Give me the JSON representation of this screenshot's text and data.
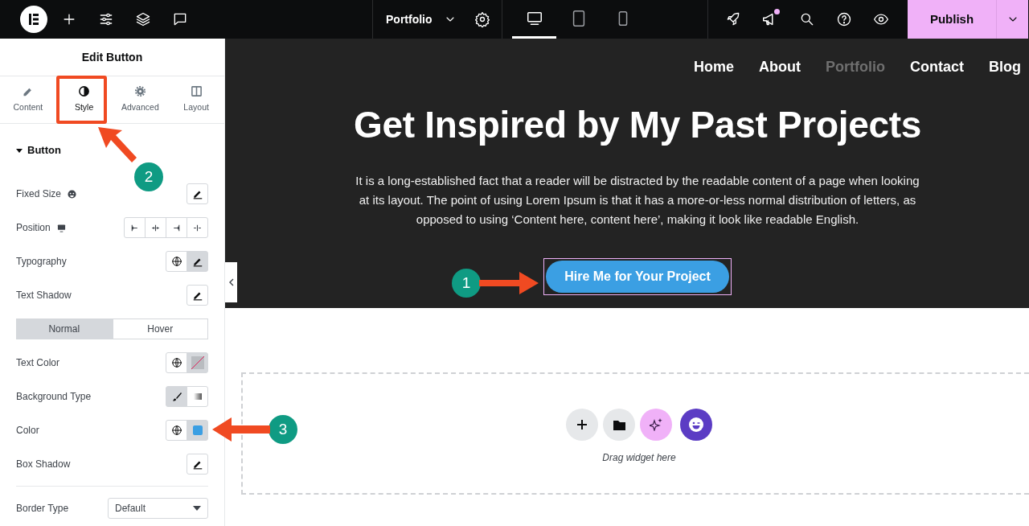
{
  "topbar": {
    "page_title": "Portfolio",
    "devices": [
      {
        "selected": true
      },
      {
        "selected": false
      },
      {
        "selected": false
      }
    ],
    "notification": true,
    "publish": "Publish"
  },
  "panel": {
    "title": "Edit Button",
    "tabs": [
      {
        "label": "Content",
        "selected": false
      },
      {
        "label": "Style",
        "selected": true
      },
      {
        "label": "Advanced",
        "selected": false
      },
      {
        "label": "Layout",
        "selected": false
      }
    ],
    "section": {
      "title": "Button",
      "expanded": true
    },
    "controls": [
      {
        "kind": "edit",
        "label": "Fixed Size",
        "dynamic": true
      },
      {
        "kind": "align",
        "label": "Position",
        "responsive": true
      },
      {
        "kind": "global_edit",
        "label": "Typography"
      },
      {
        "kind": "edit",
        "label": "Text Shadow"
      },
      {
        "kind": "states",
        "options": [
          {
            "label": "Normal",
            "selected": true
          },
          {
            "label": "Hover",
            "selected": false
          }
        ]
      },
      {
        "kind": "global_color",
        "label": "Text Color"
      },
      {
        "kind": "choice",
        "label": "Background Type",
        "options": [
          {
            "selected": true
          },
          {
            "selected": false
          }
        ]
      },
      {
        "kind": "global_color",
        "label": "Color",
        "color": "#3b9fe3"
      },
      {
        "kind": "edit",
        "label": "Box Shadow"
      },
      {
        "kind": "select",
        "label": "Border Type",
        "value": "Default"
      }
    ]
  },
  "site": {
    "nav": [
      {
        "label": "Home",
        "selected": false
      },
      {
        "label": "About",
        "selected": false
      },
      {
        "label": "Portfolio",
        "selected": true
      },
      {
        "label": "Contact",
        "selected": false
      },
      {
        "label": "Blog",
        "selected": false
      }
    ],
    "heading": "Get Inspired by My Past Projects",
    "paragraph": "It is a long-established fact that a reader will be distracted by the readable content of a page when looking at its layout. The point of using Lorem Ipsum is that it has a more-or-less normal distribution of letters, as opposed to using ‘Content here, content here’, making it look like readable English.",
    "button": "Hire Me for Your Project"
  },
  "dropzone": {
    "hint": "Drag widget here"
  },
  "annotations": [
    {
      "number": "1"
    },
    {
      "number": "2"
    },
    {
      "number": "3"
    }
  ]
}
